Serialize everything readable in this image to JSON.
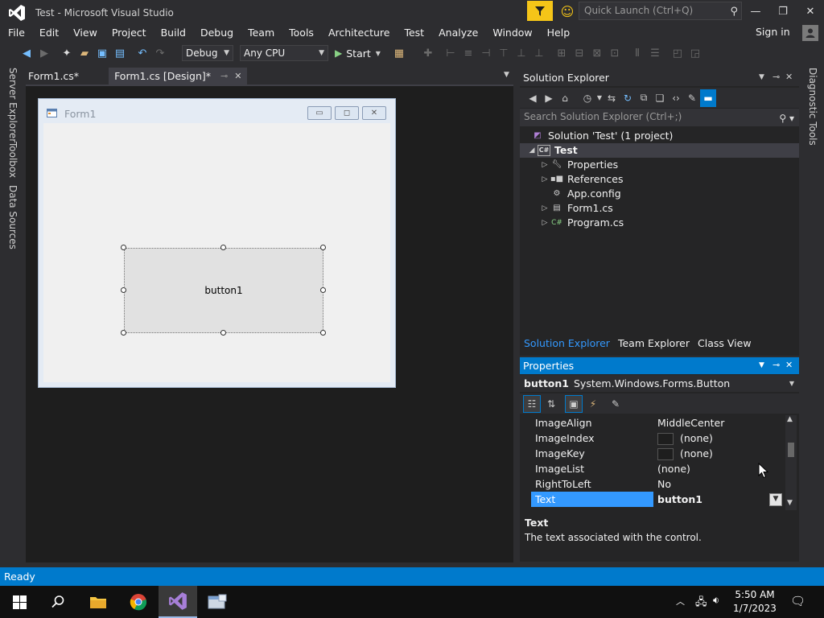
{
  "window": {
    "title": "Test - Microsoft Visual Studio",
    "quick_launch_placeholder": "Quick Launch (Ctrl+Q)",
    "sign_in": "Sign in"
  },
  "menu": [
    "File",
    "Edit",
    "View",
    "Project",
    "Build",
    "Debug",
    "Team",
    "Tools",
    "Architecture",
    "Test",
    "Analyze",
    "Window",
    "Help"
  ],
  "toolbar": {
    "config": "Debug",
    "platform": "Any CPU",
    "start_label": "Start"
  },
  "left_tabs": [
    "Server Explorer",
    "Toolbox",
    "Data Sources"
  ],
  "right_tabs": [
    "Diagnostic Tools"
  ],
  "doc_tabs": [
    {
      "label": "Form1.cs*"
    },
    {
      "label": "Form1.cs [Design]*"
    }
  ],
  "designer": {
    "form_title": "Form1",
    "button_text": "button1"
  },
  "solution_explorer": {
    "title": "Solution Explorer",
    "search_placeholder": "Search Solution Explorer (Ctrl+;)",
    "tree": [
      {
        "label": "Solution 'Test' (1 project)",
        "icon": "solution-icon"
      },
      {
        "label": "Test",
        "icon": "csharp-project-icon"
      },
      {
        "label": "Properties",
        "icon": "wrench-icon"
      },
      {
        "label": "References",
        "icon": "references-icon"
      },
      {
        "label": "App.config",
        "icon": "config-file-icon"
      },
      {
        "label": "Form1.cs",
        "icon": "form-icon"
      },
      {
        "label": "Program.cs",
        "icon": "csharp-file-icon"
      }
    ],
    "bottom_tabs": [
      "Solution Explorer",
      "Team Explorer",
      "Class View"
    ]
  },
  "properties": {
    "title": "Properties",
    "object_name": "button1",
    "object_type": "System.Windows.Forms.Button",
    "rows": [
      {
        "name": "ImageAlign",
        "value": "MiddleCenter"
      },
      {
        "name": "ImageIndex",
        "value": "(none)"
      },
      {
        "name": "ImageKey",
        "value": "(none)"
      },
      {
        "name": "ImageList",
        "value": "(none)"
      },
      {
        "name": "RightToLeft",
        "value": "No"
      },
      {
        "name": "Text",
        "value": "button1"
      }
    ],
    "desc_title": "Text",
    "desc_text": "The text associated with the control."
  },
  "status": "Ready",
  "taskbar": {
    "time": "5:50 AM",
    "date": "1/7/2023"
  },
  "colors": {
    "accent": "#007acc",
    "background": "#2d2d30",
    "vs_purple": "#68217a"
  }
}
